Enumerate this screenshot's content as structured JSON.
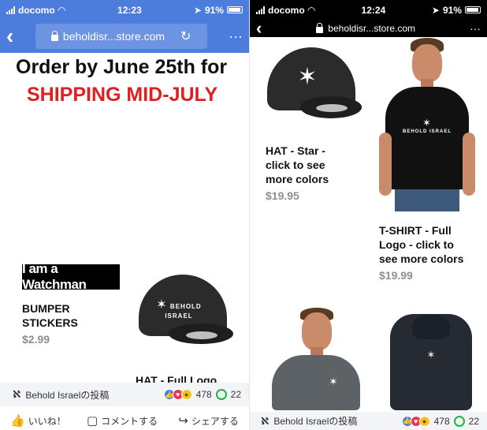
{
  "left": {
    "status": {
      "carrier": "docomo",
      "time": "12:23",
      "battery": "91%"
    },
    "urlbar": {
      "url": "beholdisr...store.com",
      "back": "‹",
      "more": "···"
    },
    "banner": {
      "line1": "Order by June 25th for",
      "line2": "SHIPPING MID-JULY"
    },
    "logo_text": "I am a Watchman",
    "products": [
      {
        "name": "BUMPER\nSTICKERS",
        "price": "$2.99"
      },
      {
        "name": "HAT - Full Logo"
      }
    ],
    "hat_logo": "BEHOLD ISRAEL",
    "fb": {
      "page": "Behold Israelの投稿",
      "reactions": "478",
      "comments": "22",
      "actions": {
        "like": "いいね！",
        "comment": "コメントする",
        "share": "シェアする"
      }
    }
  },
  "right": {
    "status": {
      "carrier": "docomo",
      "time": "12:24",
      "battery": "91%"
    },
    "urlbar": {
      "url": "beholdisr...store.com",
      "back": "‹",
      "more": "···"
    },
    "products": [
      {
        "name": "HAT - Star -\nclick to see\nmore colors",
        "price": "$19.95"
      },
      {
        "name": "T-SHIRT - Full\nLogo - click to\nsee more colors",
        "price": "$19.99"
      }
    ],
    "shirt_logo": "BEHOLD ISRAEL",
    "fb": {
      "page": "Behold Israelの投稿",
      "reactions": "478",
      "comments": "22"
    }
  },
  "colors": {
    "browser_blue": "#4c7ddc",
    "shipping_red": "#e02020",
    "price_gray": "#8b8f92"
  }
}
